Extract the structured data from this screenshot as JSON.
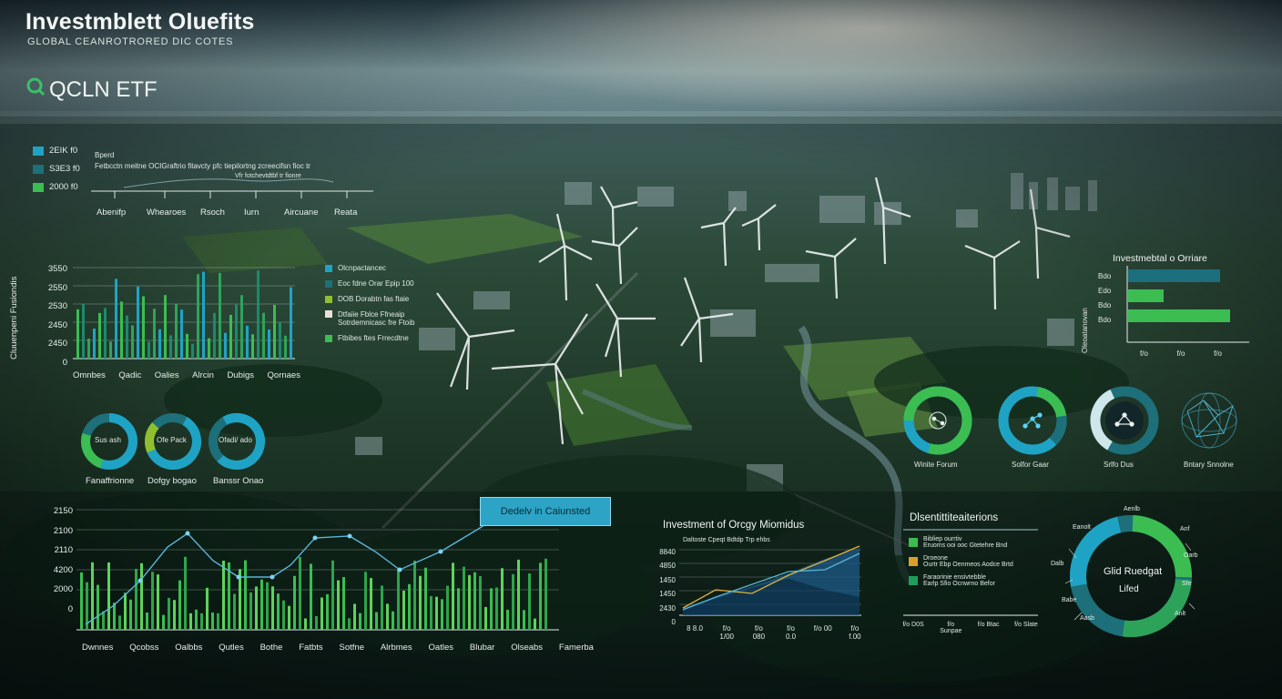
{
  "header": {
    "title": "Investmblett Oluefits",
    "subtitle": "GLOBAL CEANROTRORED DIC COTES",
    "ticker": "QCLN ETF",
    "ticker_icon": "q-logo-icon"
  },
  "top_legend": {
    "items": [
      {
        "label": "2EIK f0",
        "color": "#1fa3c4"
      },
      {
        "label": "S3E3 f0",
        "color": "#1d6f7a"
      },
      {
        "label": "2000 f0",
        "color": "#3bbd52"
      }
    ],
    "notes": [
      "Bperd",
      "Fetbcctn meitne OCIGraftrio fitavcty pfc tiepilortng zcreecifsn fioc tr",
      "Vfr fotchevtdtbf tr fionre"
    ],
    "xaxis": [
      "Abenifp",
      "Whearoes",
      "Rsoch",
      "Iurn",
      "Aircuane",
      "Reata"
    ]
  },
  "bar_chart_1": {
    "ylabel": "Cluuenpeni Fusiondis",
    "yticks": [
      "3550",
      "2550",
      "2530",
      "2450",
      "2450",
      "0"
    ],
    "xticks": [
      "Omnbes",
      "Qadic",
      "Oalies",
      "Alrcin",
      "Dubigs",
      "Qornaes"
    ],
    "legend": [
      {
        "label": "Olcnpactancec",
        "color": "#1fa3c4"
      },
      {
        "label": "Eoc fdne Orar Epip 100",
        "color": "#1d6f7a"
      },
      {
        "label": "DOB Dorabtn fas ftaie",
        "color": "#8fbf2e"
      },
      {
        "label": "Dtfaiie Fblce Ffneaip Sotrdemnicasc fre Ftoib",
        "color": "#e8e0d8"
      },
      {
        "label": "Ftbibes ftes Frrecdtne",
        "color": "#3bbd52"
      }
    ]
  },
  "donuts_left": [
    {
      "center": "Sus ash",
      "label": "Fanaffrionne",
      "slices": [
        0.55,
        0.25,
        0.2
      ]
    },
    {
      "center": "Ofe Pack",
      "label": "Dofgy bogao",
      "slices": [
        0.6,
        0.25,
        0.15
      ]
    },
    {
      "center": "Ofadi/ ado",
      "label": "Banssr Onao",
      "slices": [
        0.7,
        0.3
      ]
    }
  ],
  "center_button": {
    "label": "Dedelv in Caiunsted"
  },
  "bottom_chart": {
    "yticks": [
      "2150",
      "2100",
      "2110",
      "4200",
      "2000",
      "0"
    ],
    "xticks": [
      "Dwnnes",
      "Qcobss",
      "Oalbbs",
      "Qutles",
      "Bothe",
      "Fatbts",
      "Sotfne",
      "Alrbmes",
      "Oatles",
      "Blubar",
      "Olseabs",
      "Famerba"
    ]
  },
  "area_chart": {
    "title": "Investment of Orcgy Miomidus",
    "note": "Daltoste Cpeqt Bdtdp Trp ehbs",
    "yticks": [
      "8840",
      "4850",
      "1450",
      "1450",
      "2430",
      "0"
    ],
    "xticks": [
      "8 8.0",
      "f/o 1/00",
      "f/o 080",
      "f/o 0.0",
      "f/o 00",
      "f/o f.00"
    ]
  },
  "distribution": {
    "title": "Dlsentittiteaiterions",
    "items": [
      {
        "line1": "Bibliep ourrtiv",
        "line2": "Eruoms ooi ooc Gtetehre Bnd",
        "color": "#3bbd52"
      },
      {
        "line1": "Droeone",
        "line2": "Ourtr Ebp Oenmeos Aodce Brtd",
        "color": "#d9a12a"
      },
      {
        "line1": "Faraorinie ensivtebble",
        "line2": "Earlp Sfio Ocnwrno Befor",
        "color": "#1f9e5a"
      }
    ],
    "xticks": [
      "f/o D0S",
      "f/o Sunpae",
      "f/o Btac",
      "f/o Slate"
    ]
  },
  "right_bar": {
    "title": "Investmebtal o Orriare",
    "ylabel": "Oleoatanovan",
    "yticks": [
      "Bdo",
      "Edo",
      "Bdo",
      "Bdo"
    ],
    "xticks": [
      "f/o",
      "f/o",
      "f/o"
    ],
    "bars": [
      {
        "color": "#1c6f7c",
        "value": 0.9
      },
      {
        "color": "#3bbd52",
        "value": 0.35
      },
      {
        "color": "#3bbd52",
        "value": 1.0
      }
    ]
  },
  "donuts_right": [
    {
      "label": "Winite Forum",
      "icon": "network-icon"
    },
    {
      "label": "Solfor Gaar",
      "icon": "network-icon"
    },
    {
      "label": "Srlfo Dus",
      "icon": "network-icon"
    },
    {
      "label": "Bntary Snnolne",
      "icon": "globe-network-icon"
    }
  ],
  "big_donut": {
    "center_line1": "Glid Ruedgat",
    "center_line2": "Lifed",
    "callouts": [
      "Aenlb",
      "Eanolt",
      "Anf",
      "Oarb",
      "Dalb",
      "Sfe",
      "Babe",
      "Anlt",
      "Aasb"
    ]
  }
}
